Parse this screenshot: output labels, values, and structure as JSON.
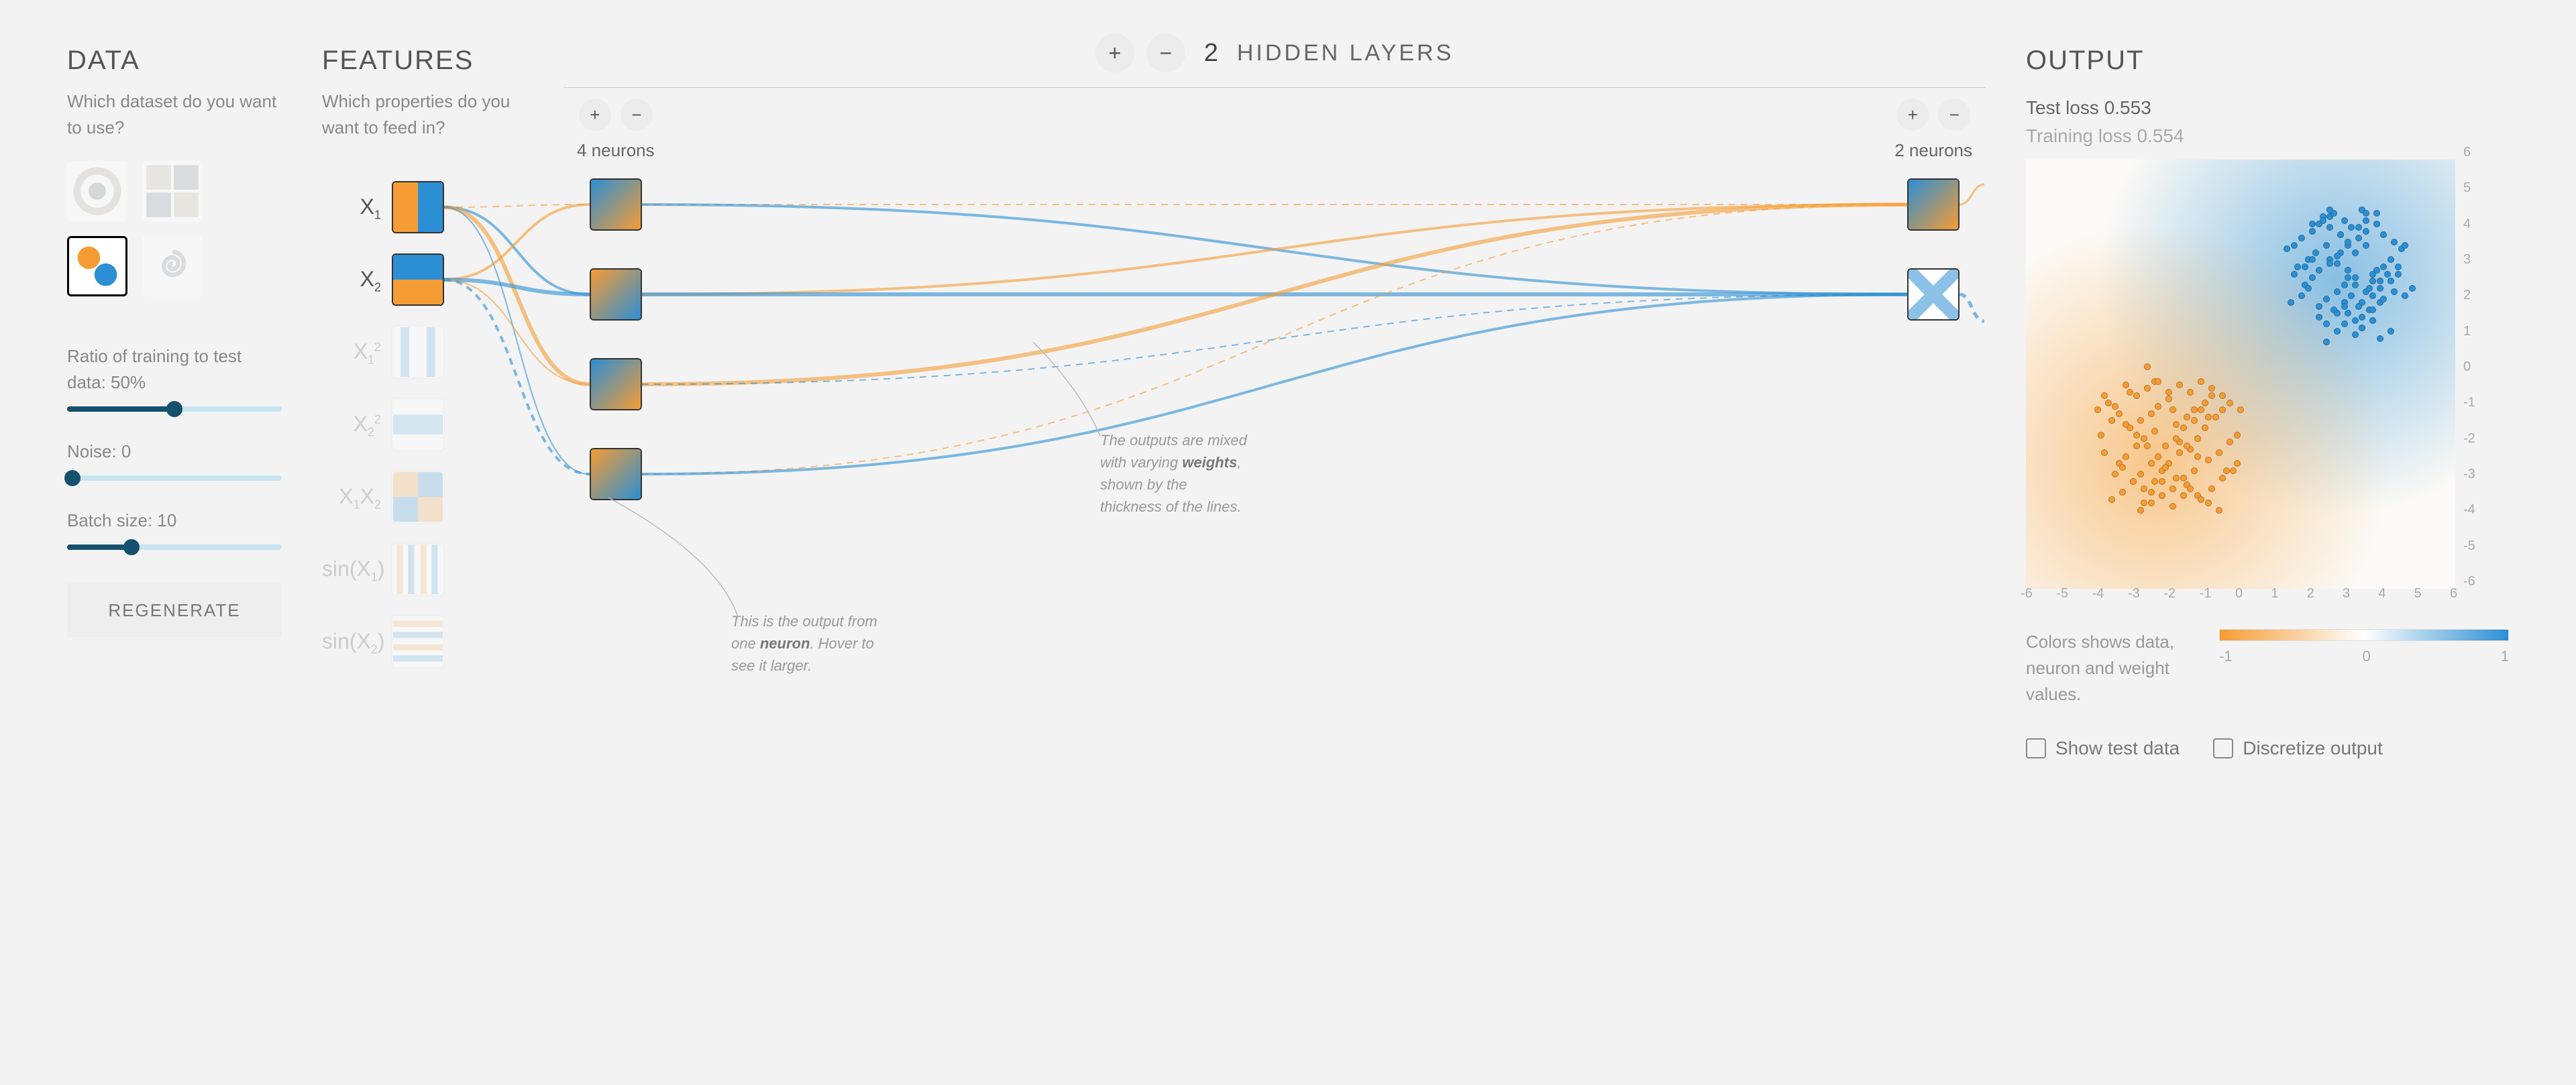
{
  "sections": {
    "data_title": "DATA",
    "features_title": "FEATURES",
    "hidden_label": "HIDDEN LAYERS",
    "output_title": "OUTPUT"
  },
  "data_panel": {
    "subtitle": "Which dataset do you want to use?",
    "datasets": [
      {
        "name": "circle",
        "selected": false
      },
      {
        "name": "xor",
        "selected": false
      },
      {
        "name": "gaussian",
        "selected": true
      },
      {
        "name": "spiral",
        "selected": false
      }
    ],
    "ratio_label": "Ratio of training to test data:  50%",
    "ratio_value_pct": 50,
    "noise_label": "Noise:  0",
    "noise_value": 0,
    "batch_label": "Batch size:  10",
    "batch_value_pct": 30,
    "regenerate": "REGENERATE"
  },
  "features_panel": {
    "subtitle": "Which properties do you want to feed in?",
    "features": [
      {
        "label": "X₁",
        "enabled": true,
        "pattern": "split-v"
      },
      {
        "label": "X₂",
        "enabled": true,
        "pattern": "split-h"
      },
      {
        "label": "X₁²",
        "enabled": false,
        "pattern": "stripes-v"
      },
      {
        "label": "X₂²",
        "enabled": false,
        "pattern": "stripes-h"
      },
      {
        "label": "X₁X₂",
        "enabled": false,
        "pattern": "checker"
      },
      {
        "label": "sin(X₁)",
        "enabled": false,
        "pattern": "sine-v"
      },
      {
        "label": "sin(X₂)",
        "enabled": false,
        "pattern": "sine-h"
      }
    ]
  },
  "network": {
    "hidden_layer_count": 2,
    "layers": [
      {
        "neurons": 4,
        "label": "4 neurons"
      },
      {
        "neurons": 2,
        "label": "2 neurons"
      }
    ],
    "neuron_caption_prefix": "This is the output from one ",
    "neuron_caption_bold": "neuron",
    "neuron_caption_suffix": ". Hover to see it larger.",
    "weights_caption_prefix": "The outputs are mixed with varying ",
    "weights_caption_bold": "weights",
    "weights_caption_suffix": ", shown by the thickness of the lines."
  },
  "output": {
    "test_loss_label": "Test loss 0.553",
    "training_loss_label": "Training loss 0.554",
    "axis_min": -6,
    "axis_max": 6,
    "axis_ticks": [
      -6,
      -5,
      -4,
      -3,
      -2,
      -1,
      0,
      1,
      2,
      3,
      4,
      5,
      6
    ],
    "legend_text": "Colors shows data, neuron and weight values.",
    "legend_ticks": [
      "-1",
      "0",
      "1"
    ],
    "show_test_data_label": "Show test data",
    "discretize_label": "Discretize output",
    "show_test_data": false,
    "discretize": false
  },
  "colors": {
    "orange": "#F59C34",
    "blue": "#2C8FD4"
  },
  "chart_data": {
    "type": "scatter",
    "title": "OUTPUT",
    "xlim": [
      -6,
      6
    ],
    "ylim": [
      -6,
      6
    ],
    "xlabel": "",
    "ylabel": "",
    "series": [
      {
        "name": "class_orange",
        "color": "#F59C34",
        "x": [
          -3.1,
          -2.8,
          -2.5,
          -2.3,
          -2.0,
          -1.8,
          -1.5,
          -1.3,
          -1.0,
          -0.8,
          -3.4,
          -3.2,
          -2.9,
          -2.7,
          -2.4,
          -2.6,
          -1.9,
          -1.7,
          -1.4,
          -1.2,
          -3.0,
          -2.8,
          -2.5,
          -2.4,
          -2.1,
          -1.8,
          -1.6,
          -1.3,
          -1.1,
          -0.9,
          -2.7,
          -2.4,
          -2.2,
          -2.0,
          -1.7,
          -1.5,
          -1.2,
          -1.0,
          -0.7,
          -0.5,
          -3.5,
          -3.3,
          -3.8,
          -3.9,
          -3.6,
          -3.1,
          -2.2,
          -1.9,
          -1.6,
          -1.3,
          -0.9,
          -0.6,
          -0.3,
          -0.1,
          -4.0,
          -3.7,
          -3.4,
          -3.2,
          -2.9,
          -2.6,
          -2.3,
          -2.1,
          -1.8,
          -1.5,
          -1.2,
          -0.9,
          -0.6,
          -0.4,
          -0.1,
          -3.6,
          -3.3,
          -3.0,
          -2.7,
          -2.5,
          -2.2,
          -1.9,
          -1.6,
          -1.4,
          -1.1,
          -0.8,
          -0.5,
          -0.2,
          -3.8,
          -3.5,
          -3.2,
          -2.9,
          -2.6,
          -2.3,
          -2.0,
          -1.7,
          -1.4,
          -1.1,
          -0.8,
          -0.5,
          -0.3,
          0.0,
          -2.8,
          -2.5,
          -2.2
        ],
        "y": [
          -1.5,
          -1.3,
          -1.1,
          -0.9,
          -0.7,
          -1.4,
          -1.2,
          -1.0,
          -0.8,
          -0.6,
          -2.5,
          -2.3,
          -2.0,
          -1.8,
          -1.6,
          0.2,
          -1.0,
          -1.9,
          -2.1,
          -2.3,
          -3.0,
          -2.8,
          -2.5,
          -0.2,
          -2.0,
          -1.8,
          -1.5,
          -1.3,
          -1.0,
          -1.2,
          -3.2,
          -3.0,
          -2.7,
          -2.5,
          -2.2,
          -2.0,
          -1.8,
          -1.5,
          -1.2,
          -1.0,
          -2.8,
          -2.6,
          -2.2,
          -1.7,
          -1.3,
          -0.5,
          -3.4,
          -3.2,
          -2.9,
          -2.7,
          -2.4,
          -2.2,
          -1.9,
          -1.7,
          -1.0,
          -0.8,
          -1.1,
          -1.4,
          -1.7,
          -2.0,
          -2.3,
          -2.6,
          -2.9,
          -3.1,
          -3.4,
          -3.6,
          -3.8,
          -2.7,
          -2.5,
          -3.5,
          -3.3,
          -3.0,
          -3.6,
          -3.3,
          -3.0,
          -3.7,
          -3.4,
          -3.2,
          -3.5,
          -3.2,
          -2.9,
          -2.7,
          -0.6,
          -0.9,
          -0.3,
          -0.6,
          -0.4,
          -0.2,
          -0.5,
          -0.3,
          -0.5,
          -0.2,
          -0.4,
          -0.6,
          -0.8,
          -1.0,
          -3.8,
          -3.6,
          -3.4
        ]
      },
      {
        "name": "class_blue",
        "color": "#2C8FD4",
        "x": [
          2.5,
          2.8,
          3.0,
          3.3,
          3.5,
          3.8,
          4.0,
          4.3,
          4.5,
          1.8,
          2.0,
          2.2,
          2.5,
          2.7,
          3.0,
          3.2,
          3.5,
          3.7,
          4.0,
          4.2,
          1.5,
          1.7,
          2.0,
          2.2,
          2.5,
          2.7,
          3.0,
          3.2,
          3.5,
          3.7,
          2.2,
          2.4,
          2.7,
          2.9,
          3.2,
          3.4,
          3.7,
          3.9,
          4.2,
          4.4,
          1.6,
          1.9,
          2.1,
          2.4,
          2.6,
          2.9,
          3.1,
          3.4,
          3.6,
          3.9,
          2.0,
          2.3,
          2.5,
          2.8,
          3.0,
          3.3,
          3.5,
          3.8,
          4.0,
          4.3,
          1.4,
          1.7,
          1.9,
          2.2,
          2.4,
          2.7,
          2.9,
          3.2,
          3.4,
          3.7,
          2.6,
          2.9,
          3.1,
          3.4,
          3.6,
          3.9,
          4.1,
          4.4,
          4.6,
          1.3,
          1.5,
          1.8,
          2.0,
          2.3,
          2.5,
          2.8,
          3.0,
          3.3,
          3.5,
          3.8,
          2.4,
          2.7,
          2.9,
          3.2,
          3.4,
          3.7,
          3.9,
          4.2,
          4.6,
          4.8
        ],
        "y": [
          3.2,
          3.4,
          3.6,
          3.8,
          4.0,
          4.2,
          3.9,
          3.7,
          3.5,
          2.5,
          2.7,
          2.9,
          3.1,
          3.3,
          2.7,
          2.5,
          2.3,
          2.8,
          3.0,
          3.2,
          3.6,
          3.8,
          4.0,
          4.2,
          4.4,
          3.1,
          2.9,
          3.4,
          3.6,
          2.6,
          1.9,
          2.1,
          2.3,
          2.5,
          2.7,
          2.0,
          2.2,
          2.4,
          2.6,
          2.8,
          3.0,
          3.2,
          3.4,
          3.6,
          1.8,
          2.0,
          2.2,
          1.6,
          1.8,
          2.0,
          4.2,
          4.4,
          4.6,
          3.9,
          3.7,
          4.1,
          4.3,
          4.5,
          2.1,
          2.3,
          2.0,
          2.2,
          2.4,
          1.6,
          1.4,
          1.7,
          1.9,
          1.5,
          1.3,
          1.8,
          4.5,
          4.3,
          4.1,
          4.6,
          2.4,
          2.6,
          2.8,
          3.0,
          2.2,
          3.5,
          2.8,
          3.0,
          3.2,
          4.3,
          4.1,
          3.9,
          1.7,
          1.9,
          4.5,
          2.9,
          0.9,
          1.2,
          1.4,
          1.1,
          1.3,
          1.5,
          1.0,
          1.2,
          3.6,
          2.4
        ]
      }
    ]
  }
}
